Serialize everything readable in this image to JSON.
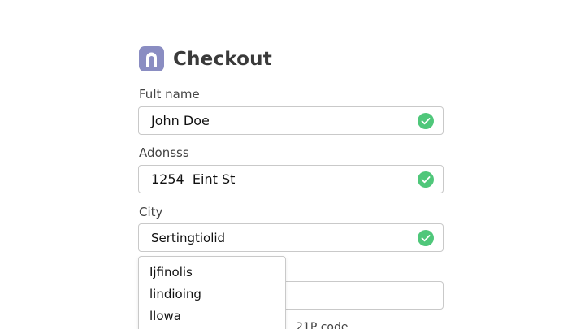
{
  "header": {
    "logo_icon": "arch-logo-icon",
    "title": "Checkout"
  },
  "form": {
    "full_name": {
      "label": "Fult name",
      "value": "John Doe",
      "valid": true
    },
    "address": {
      "label": "Adonsss",
      "value": "1254  Eint St",
      "valid": true
    },
    "city": {
      "label": "City",
      "value": "Sertingtiolid",
      "valid": true
    },
    "state": {
      "value": ""
    },
    "zip": {
      "label": "21P code"
    }
  },
  "city_dropdown": {
    "options": [
      "Ijfinolis",
      "lindioing",
      "llowa"
    ]
  },
  "colors": {
    "accent": "#8a8dc2",
    "valid": "#4fc77a",
    "border": "#c9c9c9"
  }
}
